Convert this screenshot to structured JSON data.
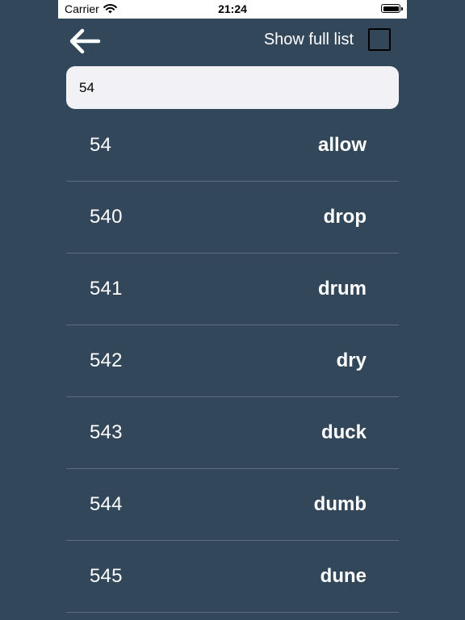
{
  "status_bar": {
    "carrier": "Carrier",
    "time": "21:24"
  },
  "header": {
    "back_icon": "arrow-left-icon",
    "show_full_list_label": "Show full list",
    "show_full_list_checked": false
  },
  "search": {
    "value": "54",
    "placeholder": ""
  },
  "list": {
    "items": [
      {
        "number": "54",
        "word": "allow"
      },
      {
        "number": "540",
        "word": "drop"
      },
      {
        "number": "541",
        "word": "drum"
      },
      {
        "number": "542",
        "word": "dry"
      },
      {
        "number": "543",
        "word": "duck"
      },
      {
        "number": "544",
        "word": "dumb"
      },
      {
        "number": "545",
        "word": "dune"
      }
    ]
  },
  "colors": {
    "background": "#32475a",
    "search_background": "#f2f2f6",
    "separator": "#5c6d7d",
    "text": "#ffffff"
  }
}
